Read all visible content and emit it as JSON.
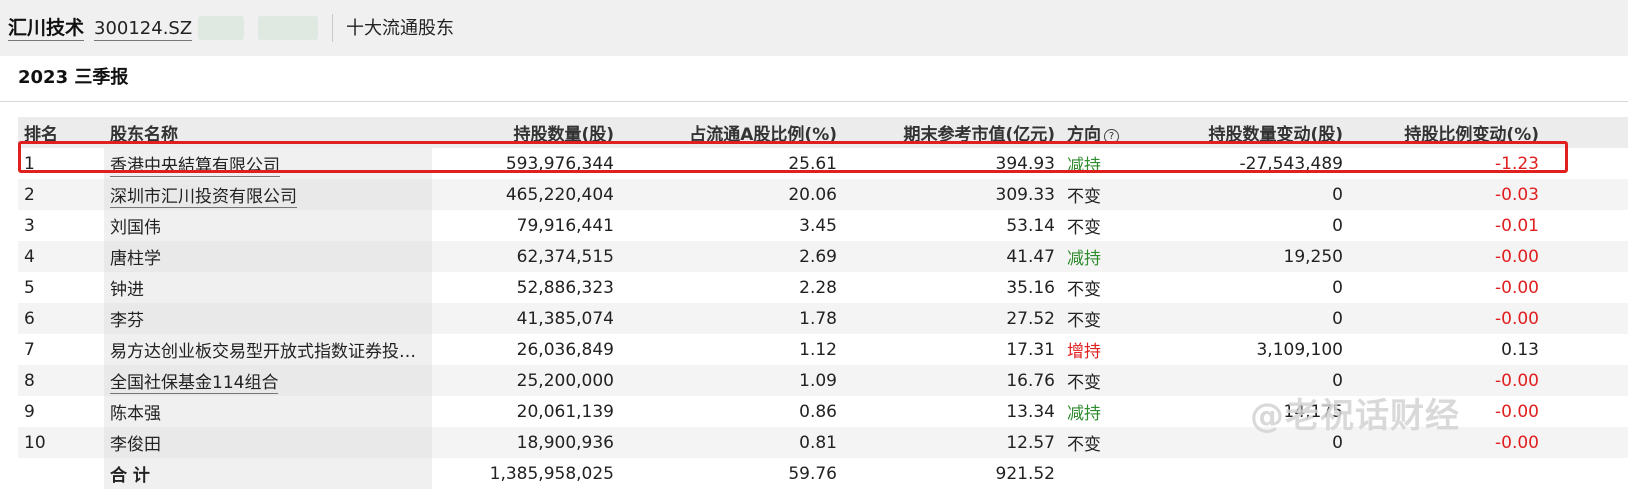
{
  "header": {
    "stock_name": "汇川技术",
    "stock_code": "300124.SZ",
    "section": "十大流通股东"
  },
  "report": {
    "title": "2023 三季报"
  },
  "table": {
    "columns": [
      "排名",
      "股东名称",
      "持股数量(股)",
      "占流通A股比例(%)",
      "期末参考市值(亿元)",
      "方向",
      "持股数量变动(股)",
      "持股比例变动(%)"
    ],
    "rows": [
      {
        "rank": "1",
        "name": "香港中央結算有限公司",
        "shares": "593,976,344",
        "ratio": "25.61",
        "value": "394.93",
        "direction": "减持",
        "share_change": "-27,543,489",
        "ratio_change": "-1.23",
        "direction_color": "#2e8b2e"
      },
      {
        "rank": "2",
        "name": "深圳市汇川投资有限公司",
        "shares": "465,220,404",
        "ratio": "20.06",
        "value": "309.33",
        "direction": "不变",
        "share_change": "0",
        "ratio_change": "-0.03"
      },
      {
        "rank": "3",
        "name": "刘国伟",
        "shares": "79,916,441",
        "ratio": "3.45",
        "value": "53.14",
        "direction": "不变",
        "share_change": "0",
        "ratio_change": "-0.01"
      },
      {
        "rank": "4",
        "name": "唐柱学",
        "shares": "62,374,515",
        "ratio": "2.69",
        "value": "41.47",
        "direction": "减持",
        "share_change": "19,250",
        "ratio_change": "-0.00"
      },
      {
        "rank": "5",
        "name": "钟进",
        "shares": "52,886,323",
        "ratio": "2.28",
        "value": "35.16",
        "direction": "不变",
        "share_change": "0",
        "ratio_change": "-0.00"
      },
      {
        "rank": "6",
        "name": "李芬",
        "shares": "41,385,074",
        "ratio": "1.78",
        "value": "27.52",
        "direction": "不变",
        "share_change": "0",
        "ratio_change": "-0.00"
      },
      {
        "rank": "7",
        "name": "易方达创业板交易型开放式指数证券投…",
        "shares": "26,036,849",
        "ratio": "1.12",
        "value": "17.31",
        "direction": "增持",
        "share_change": "3,109,100",
        "ratio_change": "0.13"
      },
      {
        "rank": "8",
        "name": "全国社保基金114组合",
        "shares": "25,200,000",
        "ratio": "1.09",
        "value": "16.76",
        "direction": "不变",
        "share_change": "0",
        "ratio_change": "-0.00"
      },
      {
        "rank": "9",
        "name": "陈本强",
        "shares": "20,061,139",
        "ratio": "0.86",
        "value": "13.34",
        "direction": "减持",
        "share_change": "14,175",
        "ratio_change": "-0.00"
      },
      {
        "rank": "10",
        "name": "李俊田",
        "shares": "18,900,936",
        "ratio": "0.81",
        "value": "12.57",
        "direction": "不变",
        "share_change": "0",
        "ratio_change": "-0.00"
      }
    ],
    "total": {
      "label": "合 计",
      "shares": "1,385,958,025",
      "ratio": "59.76",
      "value": "921.52"
    }
  },
  "watermark": "@老祝话财经",
  "colors": {
    "decrease": "#2e8b2e",
    "increase": "#e02020",
    "negative": "#e02020",
    "highlight": "#e01f1f"
  }
}
